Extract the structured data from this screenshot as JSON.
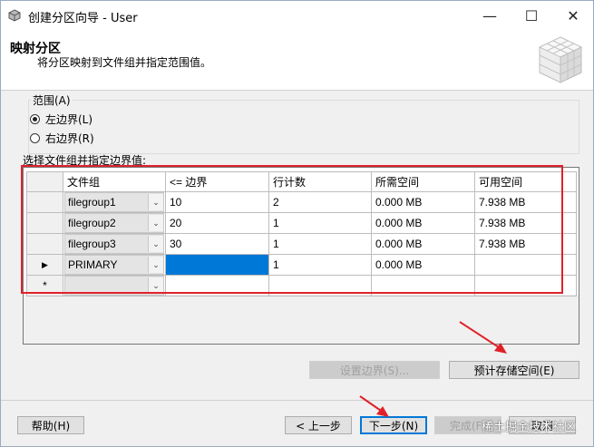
{
  "window": {
    "title": "创建分区向导 - User"
  },
  "title_controls": {
    "minimize": "—",
    "maximize": "☐",
    "close": "✕"
  },
  "header": {
    "title": "映射分区",
    "subtitle": "将分区映射到文件组并指定范围值。"
  },
  "range": {
    "label": "范围(A)",
    "options": [
      {
        "label": "左边界(L)",
        "selected": true
      },
      {
        "label": "右边界(R)",
        "selected": false
      }
    ]
  },
  "grid": {
    "caption": "选择文件组并指定边界值:",
    "columns": [
      "文件组",
      "<= 边界",
      "行计数",
      "所需空间",
      "可用空间"
    ],
    "rows": [
      {
        "marker": "",
        "filegroup": "filegroup1",
        "boundary": "10",
        "rowcount": "2",
        "required": "0.000 MB",
        "available": "7.938 MB"
      },
      {
        "marker": "",
        "filegroup": "filegroup2",
        "boundary": "20",
        "rowcount": "1",
        "required": "0.000 MB",
        "available": "7.938 MB"
      },
      {
        "marker": "",
        "filegroup": "filegroup3",
        "boundary": "30",
        "rowcount": "1",
        "required": "0.000 MB",
        "available": "7.938 MB"
      },
      {
        "marker": "▶",
        "filegroup": "PRIMARY",
        "boundary": "",
        "rowcount": "1",
        "required": "0.000 MB",
        "available": ""
      },
      {
        "marker": "*",
        "filegroup": "",
        "boundary": "",
        "rowcount": "",
        "required": "",
        "available": ""
      }
    ]
  },
  "actions": {
    "set_boundary": "设置边界(S)...",
    "estimate_storage": "预计存储空间(E)"
  },
  "footer": {
    "help": "帮助(H)",
    "prev": "< 上一步",
    "next": "下一步(N)",
    "finish": "完成(F)",
    "cancel": "取消"
  },
  "watermark": "稀土掘金技术社区",
  "colors": {
    "highlight": "#e0212a",
    "selection": "#0078d7"
  }
}
